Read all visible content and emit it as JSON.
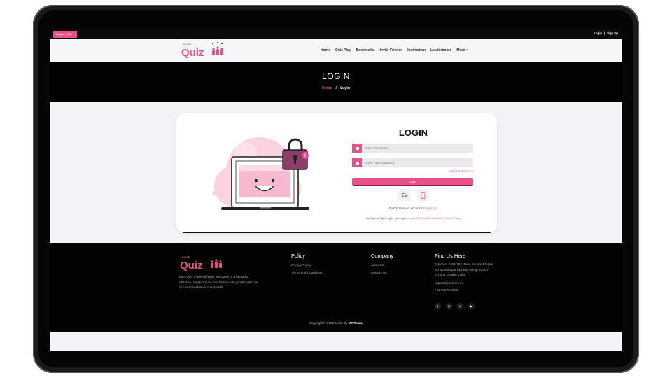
{
  "topbar": {
    "language": "English (US)",
    "language_caret": "▾",
    "login": "Login",
    "separator": "|",
    "signup": "Sign Up"
  },
  "logo": {
    "small": "ELITE",
    "main": "Quiz"
  },
  "nav": {
    "items": [
      "Home",
      "Quiz Play",
      "Bookmarks",
      "Invite Friends",
      "Instruction",
      "Leaderboard",
      "More"
    ],
    "more_caret": "▾"
  },
  "hero": {
    "title": "LOGIN",
    "breadcrumb_home": "Home",
    "breadcrumb_sep": "/",
    "breadcrumb_current": "Login"
  },
  "form": {
    "title": "LOGIN",
    "email_placeholder": "Enter Your Email",
    "password_placeholder": "Enter Your Password",
    "forgot": "Forgot Password ?",
    "login_button": "Login",
    "no_account": "Don't have an account ?",
    "signup_link": "Sign Up",
    "terms_prefix": "By Signing Up / Log in , you agree to our",
    "terms_link": "Terms and Conditions",
    "privacy_link": "Privacy Policy"
  },
  "footer": {
    "description": "Elite Quiz made with key principles of a beautiful, effective, simple to use and better code quality with use of functional based component.",
    "policy": {
      "title": "Policy",
      "items": [
        "Privacy Policy",
        "Terms and Conditions"
      ]
    },
    "company": {
      "title": "Company",
      "items": [
        "About Us",
        "Contact Us"
      ]
    },
    "find": {
      "title": "Find Us Here",
      "address": "Address: #262-263, Time Square Empire, SH 42 Mirjapar highway, Bhuj - Kutch 370001 Gujarat India.",
      "email": "support@wrteam.in",
      "phone": "+91 9797945459"
    },
    "copyright_prefix": "Copyright © 2023 Made By",
    "copyright_brand": "WRTeam."
  },
  "colors": {
    "accent": "#e8508a",
    "dark": "#020202"
  }
}
